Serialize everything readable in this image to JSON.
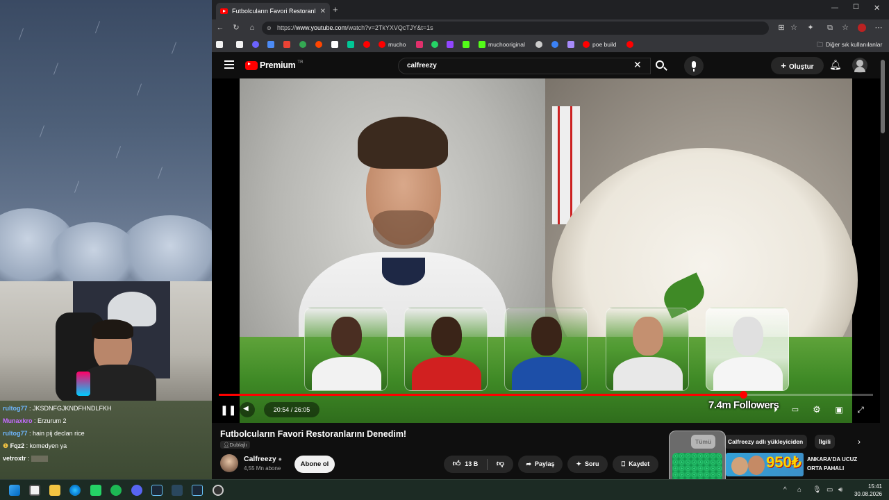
{
  "browser": {
    "tab_title": "Futbolcuların Favori Restoranlı",
    "url_prefix": "https://",
    "url_host": "www.youtube.com",
    "url_path": "/watch?v=2TkYXVQcTJY&t=1s",
    "other_bookmarks": "Diğer sık kullanılanlar"
  },
  "bookmarks": [
    {
      "label": "",
      "color": "#f2f2f2"
    },
    {
      "label": "",
      "color": "#6c63ff"
    },
    {
      "label": "",
      "color": "#4c8bf5"
    },
    {
      "label": "",
      "color": "#ea4335"
    },
    {
      "label": "",
      "color": "#34a853"
    },
    {
      "label": "",
      "color": "#ff4500"
    },
    {
      "label": "",
      "color": "#ffffff"
    },
    {
      "label": "",
      "color": "#00c896"
    },
    {
      "label": "",
      "color": "#ff0000"
    },
    {
      "label": "mucho",
      "color": "#ff0000"
    },
    {
      "label": "",
      "color": "#e1306c"
    },
    {
      "label": "",
      "color": "#25d366"
    },
    {
      "label": "",
      "color": "#9146ff"
    },
    {
      "label": "",
      "color": "#53fc18"
    },
    {
      "label": "muchooriginal",
      "color": "#53fc18"
    },
    {
      "label": "",
      "color": "#cccccc"
    },
    {
      "label": "",
      "color": "#3b82f6"
    },
    {
      "label": "",
      "color": "#a78bfa"
    },
    {
      "label": "poe build",
      "color": "#ff0000"
    },
    {
      "label": "",
      "color": "#ff0000"
    }
  ],
  "youtube": {
    "logo_text": "Premium",
    "region": "TR",
    "search_value": "calfreezy",
    "create_label": "Oluştur"
  },
  "player": {
    "current_time": "20:54",
    "duration": "26:05",
    "time_display": "20:54 / 26:05",
    "progress": 0.801,
    "overlay_text": "7.4m Followers"
  },
  "video": {
    "title": "Futbolcuların Favori Restoranlarını Denedim!",
    "dubbed_label": "Dublajlı",
    "channel": "Calfreezy",
    "subscribers": "4,55 Mn abone",
    "subscribe_label": "Abone ol",
    "likes": "13 B",
    "share_label": "Paylaş",
    "ask_label": "Soru",
    "save_label": "Kaydet"
  },
  "chips": [
    "Tümü",
    "Calfreezy adlı yükleyiciden",
    "İlgili"
  ],
  "ad": {
    "price": "950₺",
    "line1": "ANKARA'DA UCUZ",
    "line2": "ORTA PAHALI"
  },
  "chat": [
    {
      "user": "rultog77",
      "message": "JKSDNFGJKNDFHNDLFKH",
      "color": "#6fb7ff"
    },
    {
      "user": "Munaxkro",
      "message": "Erzurum 2",
      "color": "#c46cff"
    },
    {
      "user": "rultog77",
      "message": "hain pij declan rice",
      "color": "#6fb7ff"
    },
    {
      "user": "Fqz2",
      "message": "komedyen ya",
      "color": "#ffffff"
    },
    {
      "user": "vetroxtr",
      "message": "",
      "color": "#ffffff"
    }
  ],
  "taskbar": {
    "time": "15:41",
    "date": "30.08.2026"
  },
  "colors": {
    "accent": "#ff0000",
    "background": "#0f0f0f"
  }
}
